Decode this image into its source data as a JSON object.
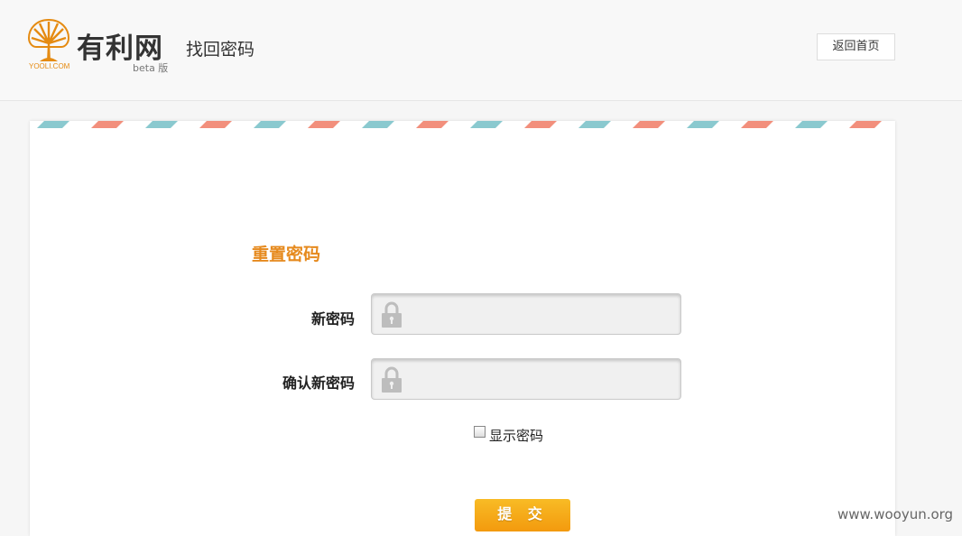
{
  "header": {
    "logo": {
      "name": "有利网",
      "domain": "YOOLI.COM",
      "beta": "beta 版",
      "brand_color": "#e58b12"
    },
    "title": "找回密码",
    "back_home_label": "返回首页"
  },
  "form": {
    "title": "重置密码",
    "title_color": "#e68a1e",
    "fields": [
      {
        "label": "新密码",
        "value": "",
        "icon": "lock-icon"
      },
      {
        "label": "确认新密码",
        "value": "",
        "icon": "lock-icon"
      }
    ],
    "show_password_label": "显示密码",
    "show_password_checked": false,
    "submit_label": "提 交",
    "submit_color": "#f5a10f"
  },
  "airmail_colors": [
    "#f28f7c",
    "#8ac9cf"
  ],
  "watermark": "www.wooyun.org"
}
